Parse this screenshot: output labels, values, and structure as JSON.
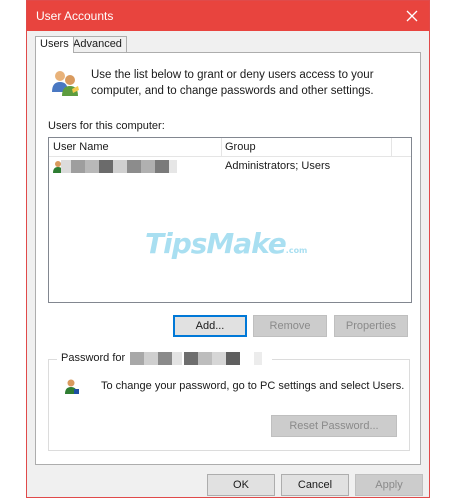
{
  "window": {
    "title": "User Accounts"
  },
  "tabs": [
    {
      "label": "Users",
      "active": true
    },
    {
      "label": "Advanced",
      "active": false
    }
  ],
  "intro_text": "Use the list below to grant or deny users access to your computer, and to change passwords and other settings.",
  "users_section": {
    "label": "Users for this computer:",
    "columns": [
      "User Name",
      "Group"
    ],
    "rows": [
      {
        "user_name": "",
        "group": "Administrators; Users"
      }
    ]
  },
  "watermark": {
    "text": "TipsMake",
    "suffix": ".com"
  },
  "list_buttons": {
    "add": "Add...",
    "remove": "Remove",
    "properties": "Properties"
  },
  "password_section": {
    "label": "Password for",
    "text": "To change your password, go to PC settings and select Users.",
    "reset_button": "Reset Password..."
  },
  "footer_buttons": {
    "ok": "OK",
    "cancel": "Cancel",
    "apply": "Apply"
  },
  "colors": {
    "titlebar": "#e8443e",
    "focus_border": "#0078d7",
    "watermark": "#a9dff1"
  }
}
